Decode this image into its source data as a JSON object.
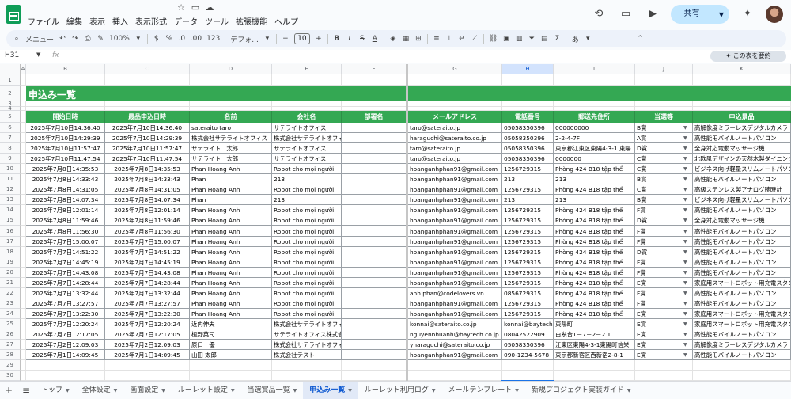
{
  "menu": [
    "ファイル",
    "編集",
    "表示",
    "挿入",
    "表示形式",
    "データ",
    "ツール",
    "拡張機能",
    "ヘルプ"
  ],
  "share_label": "共有",
  "toolbar": {
    "menu_search": "メニュー",
    "zoom": "100%",
    "currency": "$",
    "percent": "%",
    "dec_less": ".0",
    "dec_more": ".00",
    "number_format": "123",
    "font": "デフォ...",
    "font_size": "10",
    "bold": "B",
    "italic": "I",
    "strike": "S",
    "text_color": "A",
    "input_tools": "あ"
  },
  "formula_bar": {
    "name_box": "H31",
    "fx": "fx",
    "value": ""
  },
  "summarize_label": "この表を要約",
  "columns": [
    "A",
    "B",
    "C",
    "D",
    "E",
    "F",
    "G",
    "H",
    "I",
    "J",
    "K"
  ],
  "selected_column": "H",
  "selected_row": "31",
  "row_numbers": [
    "1",
    "2",
    "3",
    "4",
    "5",
    "6",
    "7",
    "8",
    "9",
    "10",
    "11",
    "12",
    "13",
    "14",
    "15",
    "16",
    "17",
    "18",
    "19",
    "20",
    "21",
    "22",
    "23",
    "24",
    "25",
    "26",
    "27",
    "28",
    "29",
    "30",
    "31",
    "32"
  ],
  "sheet_title": "申込み一覧",
  "table_headers": [
    "開始日時",
    "最品申込日時",
    "名前",
    "会社名",
    "部署名",
    "メールアドレス",
    "電話番号",
    "郵送先住所",
    "当選等",
    "申込景品"
  ],
  "rows": [
    [
      "2025年7月10日14:36:40",
      "2025年7月10日14:36:40",
      "sateraito taro",
      "サテライトオフィス",
      "",
      "taro@sateraito.jp",
      "05058350396",
      "000000000",
      "B賞",
      "高解像度ミラーレスデジタルカメラ"
    ],
    [
      "2025年7月10日14:29:39",
      "2025年7月10日14:29:39",
      "株式会社サテライトオフィス",
      "株式会社サテライトオフィス",
      "",
      "haraguchi@sateraito.co.jp",
      "05058350396",
      "2-2-4-7F",
      "A賞",
      "高性能モバイルノートパソコン"
    ],
    [
      "2025年7月10日11:57:47",
      "2025年7月10日11:57:47",
      "サテライト　太郎",
      "サテライトオフィス",
      "",
      "taro@sateraito.jp",
      "05058350396",
      "東京都江東区東陽4-3-1 東陽",
      "D賞",
      "全身対応電動マッサージ機"
    ],
    [
      "2025年7月10日11:47:54",
      "2025年7月10日11:47:54",
      "サテライト　太郎",
      "サテライトオフィス",
      "",
      "taro@sateraito.jp",
      "05058350396",
      "0000000",
      "C賞",
      "北欧風デザインの天然木製ダイニング"
    ],
    [
      "2025年7月8日14:35:53",
      "2025年7月8日14:35:53",
      "Phan Hoang Anh",
      "Robot cho mọi người",
      "",
      "hoanganhphan91@gmail.com",
      "1256729315",
      "Phòng 424 B18 tập thể",
      "C賞",
      "ビジネス向け軽量スリムノートパソコン"
    ],
    [
      "2025年7月8日14:33:43",
      "2025年7月8日14:33:43",
      "Phan",
      "213",
      "",
      "hoanganhphan91@gmail.com",
      "213",
      "213",
      "B賞",
      "高性能モバイルノートパソコン"
    ],
    [
      "2025年7月8日14:31:05",
      "2025年7月8日14:31:05",
      "Phan Hoang Anh",
      "Robot cho mọi người",
      "",
      "hoanganhphan91@gmail.com",
      "1256729315",
      "Phòng 424 B18 tập thể",
      "C賞",
      "高級ステンレス製アナログ腕時計"
    ],
    [
      "2025年7月8日14:07:34",
      "2025年7月8日14:07:34",
      "Phan",
      "213",
      "",
      "hoanganhphan91@gmail.com",
      "213",
      "213",
      "B賞",
      "ビジネス向け軽量スリムノートパソコン"
    ],
    [
      "2025年7月8日12:01:14",
      "2025年7月8日12:01:14",
      "Phan Hoang Anh",
      "Robot cho mọi người",
      "",
      "hoanganhphan91@gmail.com",
      "1256729315",
      "Phòng 424 B18 tập thể",
      "F賞",
      "高性能モバイルノートパソコン"
    ],
    [
      "2025年7月8日11:59:46",
      "2025年7月8日11:59:46",
      "Phan Hoang Anh",
      "Robot cho mọi người",
      "",
      "hoanganhphan91@gmail.com",
      "1256729315",
      "Phòng 424 B18 tập thể",
      "D賞",
      "全身対応電動マッサージ機"
    ],
    [
      "2025年7月8日11:56:30",
      "2025年7月8日11:56:30",
      "Phan Hoang Anh",
      "Robot cho mọi người",
      "",
      "hoanganhphan91@gmail.com",
      "1256729315",
      "Phòng 424 B18 tập thể",
      "F賞",
      "高性能モバイルノートパソコン"
    ],
    [
      "2025年7月7日15:00:07",
      "2025年7月7日15:00:07",
      "Phan Hoang Anh",
      "Robot cho mọi người",
      "",
      "hoanganhphan91@gmail.com",
      "1256729315",
      "Phòng 424 B18 tập thể",
      "F賞",
      "高性能モバイルノートパソコン"
    ],
    [
      "2025年7月7日14:51:22",
      "2025年7月7日14:51:22",
      "Phan Hoang Anh",
      "Robot cho mọi người",
      "",
      "hoanganhphan91@gmail.com",
      "1256729315",
      "Phòng 424 B18 tập thể",
      "D賞",
      "高性能モバイルノートパソコン"
    ],
    [
      "2025年7月7日14:45:19",
      "2025年7月7日14:45:19",
      "Phan Hoang Anh",
      "Robot cho mọi người",
      "",
      "hoanganhphan91@gmail.com",
      "1256729315",
      "Phòng 424 B18 tập thể",
      "F賞",
      "高性能モバイルノートパソコン"
    ],
    [
      "2025年7月7日14:43:08",
      "2025年7月7日14:43:08",
      "Phan Hoang Anh",
      "Robot cho mọi người",
      "",
      "hoanganhphan91@gmail.com",
      "1256729315",
      "Phòng 424 B18 tập thể",
      "F賞",
      "高性能モバイルノートパソコン"
    ],
    [
      "2025年7月7日14:28:44",
      "2025年7月7日14:28:44",
      "Phan Hoang Anh",
      "Robot cho mọi người",
      "",
      "hoanganhphan91@gmail.com",
      "1256729315",
      "Phòng 424 B18 tập thể",
      "E賞",
      "家庭用スマートロボット用充電スタンド"
    ],
    [
      "2025年7月7日13:32:44",
      "2025年7月7日13:32:44",
      "Phan Hoang Anh",
      "Robot cho mọi người",
      "",
      "anh.phan@codelovers.vn",
      "0856729315",
      "Phòng 424 B18 tập thể",
      "F賞",
      "高性能モバイルノートパソコン"
    ],
    [
      "2025年7月7日13:27:57",
      "2025年7月7日13:27:57",
      "Phan Hoang Anh",
      "Robot cho mọi người",
      "",
      "hoanganhphan91@gmail.com",
      "1256729315",
      "Phòng 424 B18 tập thể",
      "F賞",
      "高性能モバイルノートパソコン"
    ],
    [
      "2025年7月7日13:22:30",
      "2025年7月7日13:22:30",
      "Phan Hoang Anh",
      "Robot cho mọi người",
      "",
      "hoanganhphan91@gmail.com",
      "1256729315",
      "Phòng 424 B18 tập thể",
      "E賞",
      "家庭用スマートロボット用充電スタンド"
    ],
    [
      "2025年7月7日12:20:24",
      "2025年7月7日12:20:24",
      "近内伸夫",
      "株式会社サテライトオフィス",
      "",
      "konnai@sateraito.co.jp",
      "konnai@baytech",
      "東陽町",
      "E賞",
      "家庭用スマートロボット用充電スタンド"
    ],
    [
      "2025年7月7日12:17:05",
      "2025年7月7日12:17:05",
      "植野英司",
      "サテライトオフィス株式会社",
      "",
      "nguyennhuanh@baytech.co.jp",
      "08042522909",
      "白糸台1－7－2－2 1",
      "E賞",
      "高性能モバイルノートパソコン"
    ],
    [
      "2025年7月2日12:09:03",
      "2025年7月2日12:09:03",
      "原口　優",
      "株式会社サテライトオフィス",
      "",
      "yharaguchi@sateraito.co.jp",
      "05058350396",
      "江東区東陽4-3-1東陽町信栄",
      "E賞",
      "高解像度ミラーレスデジタルカメラ"
    ],
    [
      "2025年7月1日14:09:45",
      "2025年7月1日14:09:45",
      "山田 太郎",
      "株式会社テスト",
      "",
      "hoanganhphan91@gmail.com",
      "090-1234-5678",
      "東京都新宿区西新宿2-8-1",
      "E賞",
      "高性能モバイルノートパソコン"
    ]
  ],
  "sheet_tabs": [
    "トップ",
    "全体設定",
    "画面設定",
    "ルーレット設定",
    "当選賞品一覧",
    "申込み一覧",
    "ルーレット利用ログ",
    "メールテンプレート",
    "新規プロジェクト実装ガイド"
  ],
  "active_tab": "申込み一覧",
  "colors": {
    "header_green": "#34a853",
    "selection_blue": "#1a73e8",
    "active_tab_text": "#0b57d0"
  }
}
